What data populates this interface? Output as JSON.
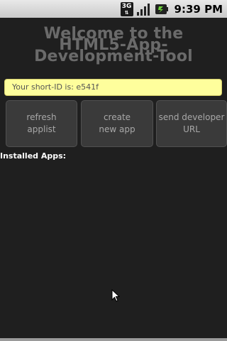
{
  "status_bar": {
    "network": "3G",
    "time": "9:39 PM",
    "icons": [
      "3g-icon",
      "signal-icon",
      "battery-icon"
    ]
  },
  "page": {
    "title_lines": [
      "Welcome to the",
      "HTML5-App-",
      "Development-Tool"
    ],
    "short_id_text": "Your short-ID is: e541f",
    "buttons": {
      "refresh": "refresh\napplist",
      "create": "create\nnew app",
      "send": "send developer\nURL"
    },
    "installed_label": "Installed Apps:"
  },
  "colors": {
    "background": "#1f1f1f",
    "banner": "#fefe9c",
    "button": "#3a3a3a"
  }
}
